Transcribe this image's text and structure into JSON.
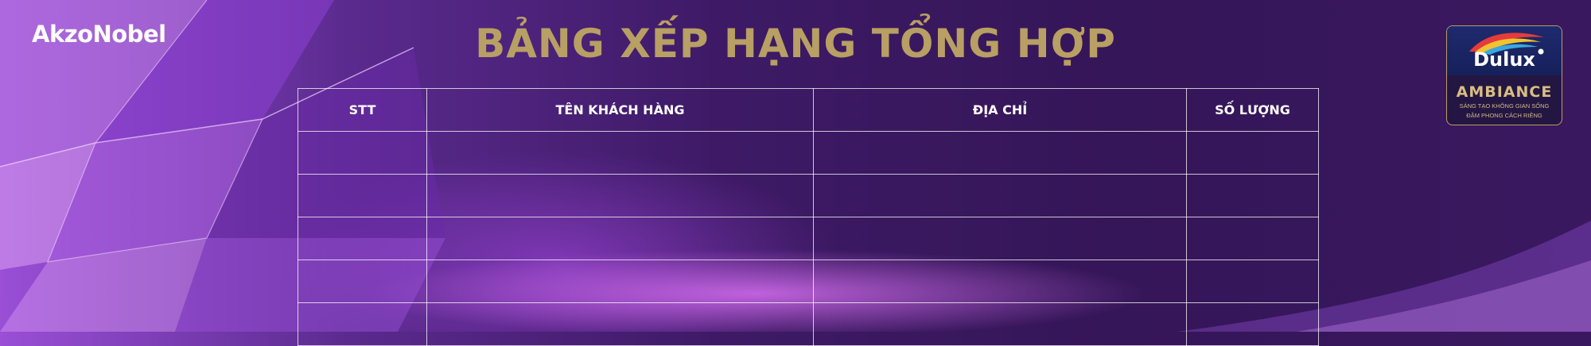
{
  "brand": {
    "left_logo": "AkzoNobel",
    "right_logo_top": "Dulux",
    "right_logo_name": "AMBIANCE",
    "right_logo_tagline_1": "SÁNG TẠO KHÔNG GIAN SỐNG",
    "right_logo_tagline_2": "ĐẬM PHONG CÁCH RIÊNG"
  },
  "title": "BẢNG XẾP HẠNG TỔNG HỢP",
  "table": {
    "headers": [
      "STT",
      "TÊN KHÁCH HÀNG",
      "ĐỊA CHỈ",
      "SỐ LƯỢNG"
    ],
    "rows": [
      [
        "",
        "",
        "",
        ""
      ],
      [
        "",
        "",
        "",
        ""
      ],
      [
        "",
        "",
        "",
        ""
      ],
      [
        "",
        "",
        "",
        ""
      ],
      [
        "",
        "",
        "",
        ""
      ]
    ]
  },
  "colors": {
    "title_gold": "#b89f63",
    "background_purple": "#3e1a66",
    "grid_white": "#ffffff"
  }
}
